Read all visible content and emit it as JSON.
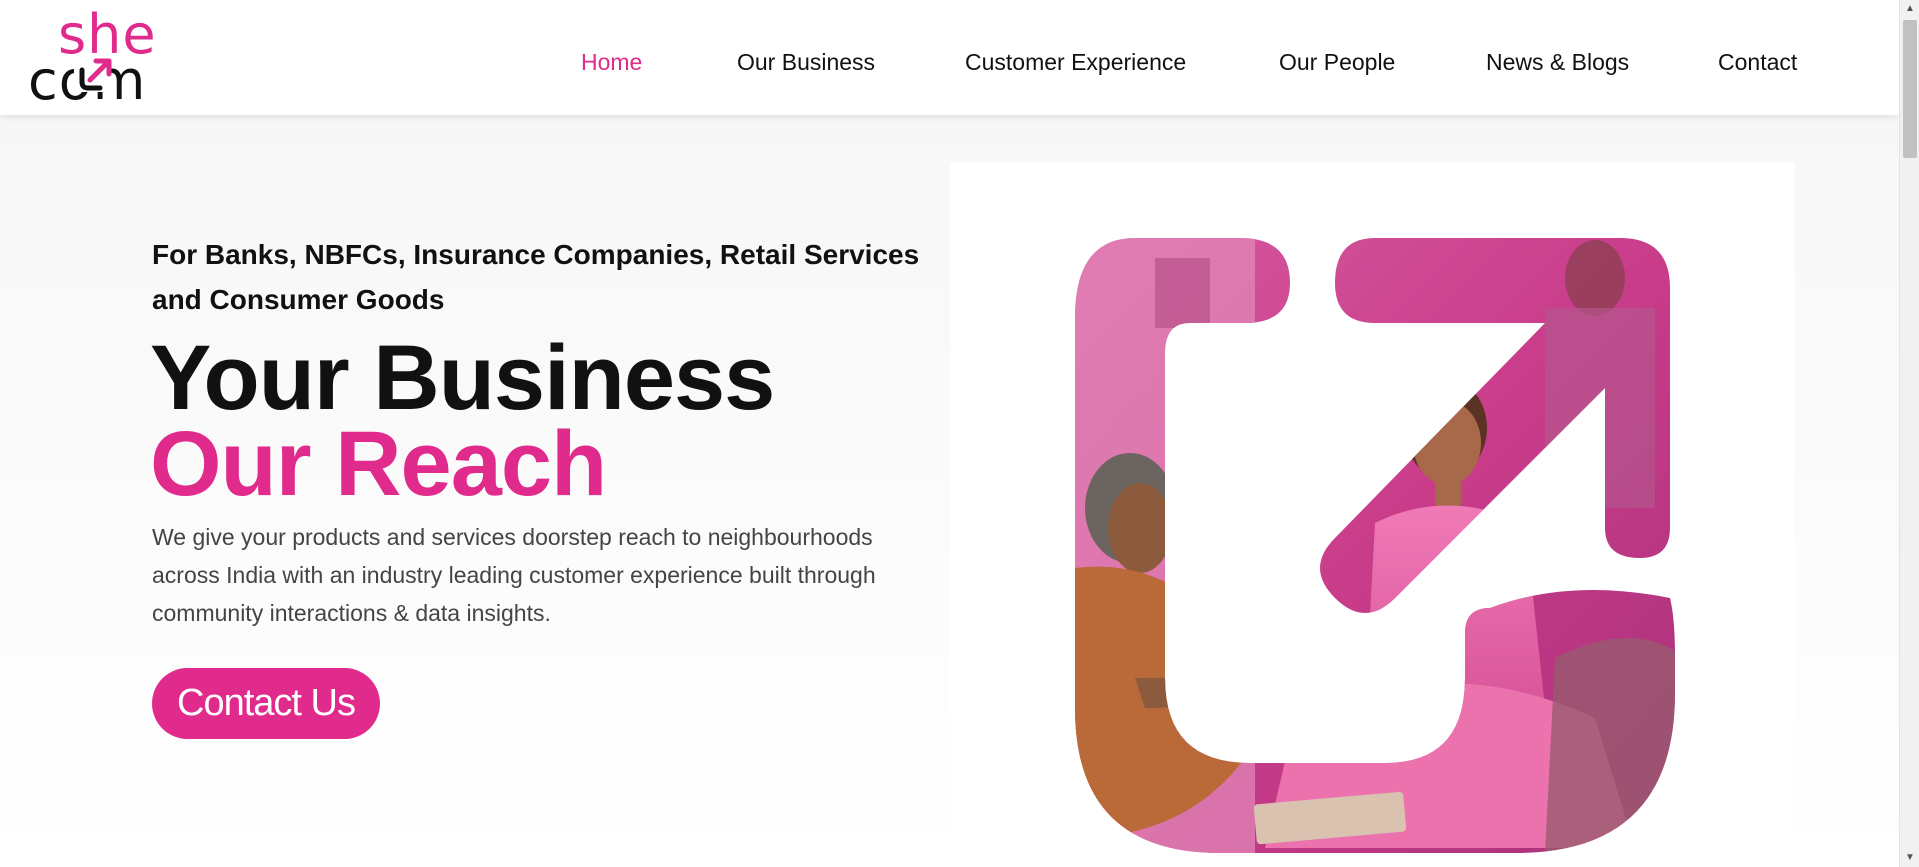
{
  "logo": {
    "top_text": "she",
    "bottom_text": "com",
    "icon": "arrow-up-right-icon"
  },
  "nav": {
    "items": [
      {
        "label": "Home",
        "active": true
      },
      {
        "label": "Our Business",
        "active": false
      },
      {
        "label": "Customer Experience",
        "active": false
      },
      {
        "label": "Our People",
        "active": false
      },
      {
        "label": "News & Blogs",
        "active": false
      },
      {
        "label": "Contact",
        "active": false
      }
    ]
  },
  "hero": {
    "subtitle": "For Banks, NBFCs, Insurance Companies, Retail Services and Consumer Goods",
    "headline_line1": "Your Business",
    "headline_line2": "Our Reach",
    "description": "We give your products and services doorstep reach to neighbourhoods across India with an industry leading customer experience built through community interactions & data insights.",
    "cta_label": "Contact Us",
    "image": "women-meeting-in-arrow-shape-illustration"
  },
  "colors": {
    "brand_pink": "#e02a8c",
    "text_dark": "#111111",
    "text_muted": "#444444"
  }
}
